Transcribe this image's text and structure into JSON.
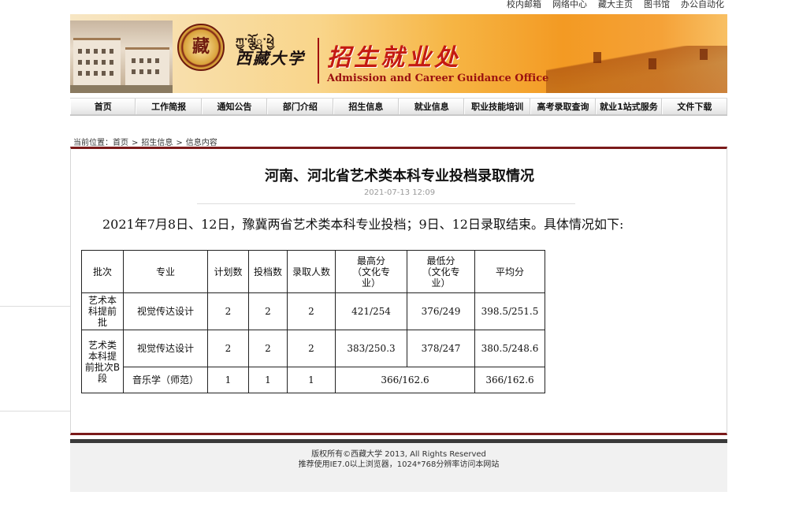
{
  "top_links": [
    "校内邮箱",
    "网络中心",
    "藏大主页",
    "图书馆",
    "办公自动化"
  ],
  "banner": {
    "tibetan": "ཀྱཱ༌ལྕོྤ༌ཕྱེ",
    "university_name": "西藏大学",
    "emblem_glyph": "藏",
    "office_cn": "招生就业处",
    "office_en": "Admission and Career Guidance Office"
  },
  "nav": [
    "首页",
    "工作简报",
    "通知公告",
    "部门介绍",
    "招生信息",
    "就业信息",
    "职业技能培训",
    "高考录取查询",
    "就业1站式服务",
    "文件下载"
  ],
  "breadcrumb": {
    "prefix": "当前位置：",
    "items": [
      "首页",
      ">",
      "招生信息",
      ">",
      "信息内容"
    ]
  },
  "article": {
    "title": "河南、河北省艺术类本科专业投档录取情况",
    "date": "2021-07-13 12:09",
    "lead": "2021年7月8日、12日，豫冀两省艺术类本科专业投档；9日、12日录取结束。具体情况如下:",
    "table": {
      "headers": [
        "批次",
        "专业",
        "计划数",
        "投档数",
        "录取人数",
        "最高分（文化专业）",
        "最低分（文化专业）",
        "平均分"
      ],
      "header_lines": {
        "max": [
          "最高分",
          "（文化专",
          "业）"
        ],
        "min": [
          "最低分",
          "（文化专",
          "业）"
        ]
      },
      "batch1": "艺术本科提前批",
      "batch1_lines": [
        "艺术本",
        "科提前",
        "批"
      ],
      "batch2": "艺术类本科提前批次B段",
      "batch2_lines": [
        "艺术类",
        "本科提",
        "前批次B",
        "段"
      ],
      "rows": [
        {
          "major": "视觉传达设计",
          "plan": "2",
          "filed": "2",
          "admitted": "2",
          "max": "421/254",
          "min": "376/249",
          "avg": "398.5/251.5"
        },
        {
          "major": "视觉传达设计",
          "plan": "2",
          "filed": "2",
          "admitted": "2",
          "max": "383/250.3",
          "min": "378/247",
          "avg": "380.5/248.6"
        },
        {
          "major": "音乐学（师范）",
          "plan": "1",
          "filed": "1",
          "admitted": "1",
          "maxmin": "366/162.6",
          "avg": "366/162.6"
        }
      ]
    }
  },
  "footer": {
    "line1": "版权所有©西藏大学 2013, All Rights Reserved",
    "line2": "推荐使用IE7.0以上浏览器，1024*768分辨率访问本网站"
  },
  "colors": {
    "accent_dark_red": "#7b1a1a",
    "office_red": "#c41a12",
    "banner_orange": "#f39a23"
  }
}
